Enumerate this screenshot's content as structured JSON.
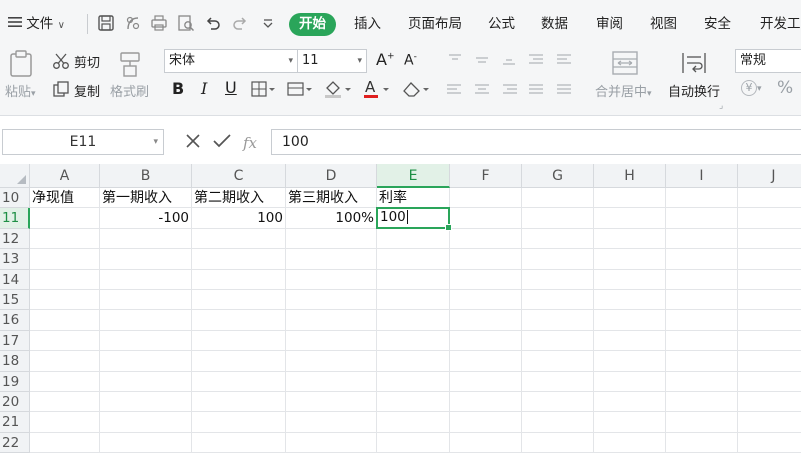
{
  "menubar": {
    "file_label": "文件",
    "tabs": [
      "开始",
      "插入",
      "页面布局",
      "公式",
      "数据",
      "审阅",
      "视图",
      "安全",
      "开发工"
    ],
    "active_tab": "开始"
  },
  "ribbon": {
    "paste_label": "粘贴",
    "cut_label": "剪切",
    "copy_label": "复制",
    "format_painter_label": "格式刷",
    "font_name": "宋体",
    "font_size": "11",
    "merge_center_label": "合并居中",
    "wrap_text_label": "自动换行",
    "number_format": "常规",
    "percent_symbol": "%",
    "currency_symbol": "¥"
  },
  "formula_bar": {
    "name_box": "E11",
    "fx_label": "fx",
    "value": "100"
  },
  "sheet": {
    "columns": [
      "A",
      "B",
      "C",
      "D",
      "E",
      "F",
      "G",
      "H",
      "I",
      "J"
    ],
    "selected_column": "E",
    "rows": [
      "10",
      "11",
      "12",
      "13",
      "14",
      "15",
      "16",
      "17",
      "18",
      "19",
      "20",
      "21",
      "22"
    ],
    "selected_row": "11",
    "row10": {
      "A": "净现值",
      "B": "第一期收入",
      "C": "第二期收入",
      "D": "第三期收入",
      "E": "利率"
    },
    "row11": {
      "B": "-100",
      "C": "100",
      "D": "100%",
      "E": "100"
    }
  },
  "colors": {
    "accent": "#2aa55a",
    "header_bg": "#f1f3f5",
    "ribbon_bg": "#f5f6f7"
  }
}
